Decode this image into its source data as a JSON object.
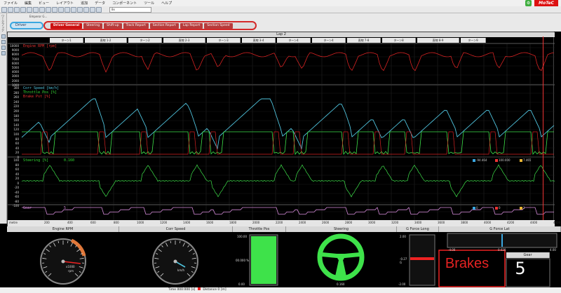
{
  "menu": [
    "ファイル",
    "編集",
    "ビュー",
    "レイアウト",
    "追加",
    "データ",
    "コンポーネント",
    "ツール",
    "ヘルプ"
  ],
  "brand": {
    "logo": "MoTeC",
    "settings_glyph": "⚙"
  },
  "toolbar": {
    "select_value": "8x"
  },
  "window": {
    "title": "Emperor G..."
  },
  "sidebar": {
    "label": "ワークブック"
  },
  "tabs": {
    "driver": "Driver",
    "worksheets": [
      "Driver General",
      "Steering",
      "Shift-up",
      "Track Report",
      "Section Report",
      "Lap Report",
      "Section Speed"
    ],
    "active_index": 0
  },
  "chart": {
    "lap_label": "Lap 2",
    "turns": [
      "ターン1",
      "直線 1-2",
      "ターン2",
      "直線 2-3",
      "ターン3",
      "直線 3-4",
      "ターン4",
      "ターン4",
      "直線 7-8",
      "ターン8",
      "直線 8-9",
      "ターン9"
    ],
    "panels": {
      "rpm": {
        "label": "Engine RPM [rpm]"
      },
      "speed": {
        "labels": [
          "Corr Speed [km/h]",
          "Throttle Pos [%]",
          "Brake Pst [%]"
        ]
      },
      "steering": {
        "label": "Steering [%]",
        "value": "0.160",
        "readouts": [
          "-94.464",
          "100.000",
          "7.465"
        ]
      },
      "gear": {
        "label": "Gear",
        "value": "5",
        "readouts": [
          "0",
          "0",
          "2"
        ]
      }
    },
    "x_ticks": [
      "200",
      "400",
      "600",
      "800",
      "1000",
      "1200",
      "1400",
      "1600",
      "1800",
      "2000",
      "2200",
      "2400",
      "2600",
      "2800",
      "3000",
      "3200",
      "3400",
      "3600",
      "3800",
      "4000",
      "4200",
      "4400",
      "4600"
    ],
    "xaxis_label": "metre",
    "rpm_ticks": [
      "10000",
      "9000",
      "8000",
      "7000",
      "6000",
      "5000",
      "4000",
      "3000",
      "2000",
      "1000"
    ],
    "speed_ticks": [
      "300",
      "280",
      "260",
      "240",
      "220",
      "200",
      "180",
      "160",
      "140",
      "120",
      "100",
      "80",
      "60",
      "40",
      "20",
      "0"
    ],
    "steer_ticks": [
      "100",
      "80",
      "60",
      "40",
      "20",
      "0",
      "-20",
      "-40",
      "-60",
      "-80",
      "-100"
    ]
  },
  "gauges": {
    "headers": [
      "Engine RPM",
      "Corr Speed",
      "Throttle Pos",
      "Steering",
      "G Force Long",
      "G Force Lat",
      "Gear"
    ],
    "rpm_units": [
      "x1000",
      "rpm"
    ],
    "speed_unit": "km/h",
    "throttle": {
      "top": "100.00",
      "mid": "00.000 %",
      "bottom": "0.00"
    },
    "steering_readout": "0.160",
    "glong": {
      "top": "2.00",
      "mid": "-0.27\nG",
      "bottom": "-2.00"
    },
    "glat": {
      "left": "-4.00",
      "mid": "0.020",
      "right": "4.00"
    },
    "brakes_label": "Brakes",
    "gear_value": "5"
  },
  "status": {
    "time": "Time 000:000 [s]",
    "distance": "Distance 0 [m]"
  }
}
